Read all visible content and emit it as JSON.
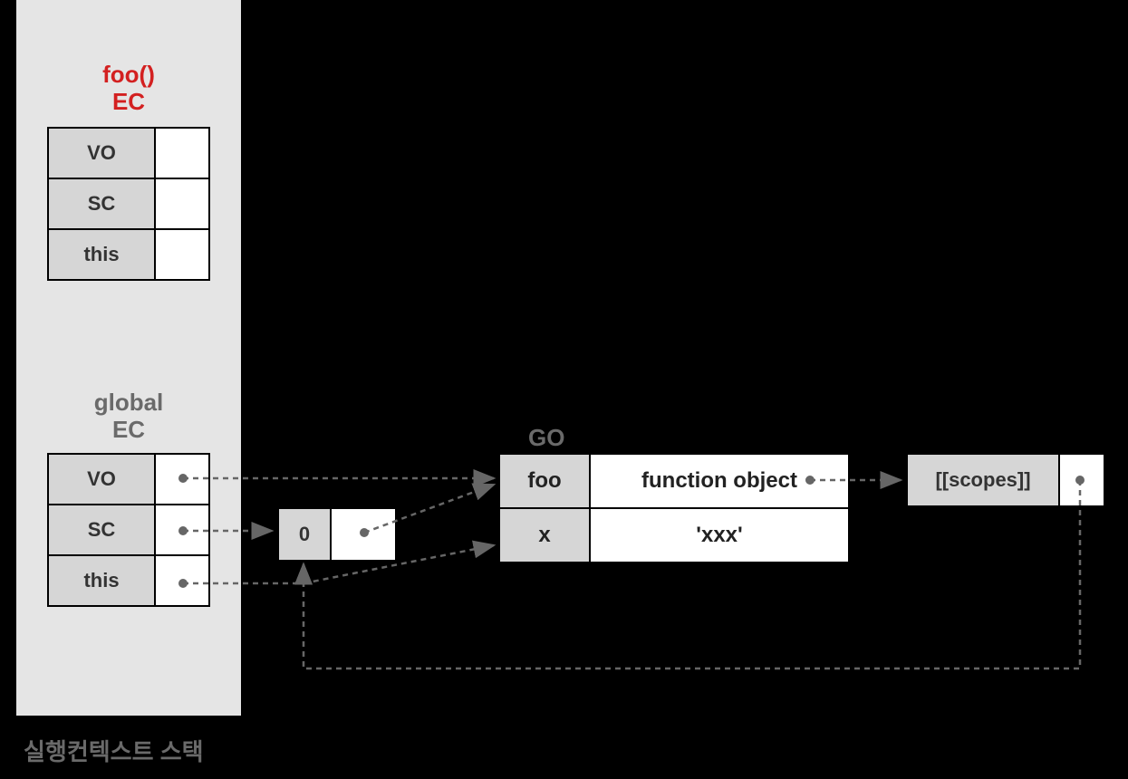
{
  "stack": {
    "caption": "실행컨텍스트 스택",
    "contexts": [
      {
        "title_line1": "foo()",
        "title_line2": "EC",
        "color": "red",
        "rows": [
          "VO",
          "SC",
          "this"
        ]
      },
      {
        "title_line1": "global",
        "title_line2": "EC",
        "color": "gray",
        "rows": [
          "VO",
          "SC",
          "this"
        ]
      }
    ]
  },
  "scopeChain": {
    "index": "0"
  },
  "go": {
    "label": "GO",
    "rows": [
      {
        "key": "foo",
        "value": "function object"
      },
      {
        "key": "x",
        "value": "'xxx'"
      }
    ]
  },
  "functionObject": {
    "scopesLabel": "[[scopes]]"
  }
}
